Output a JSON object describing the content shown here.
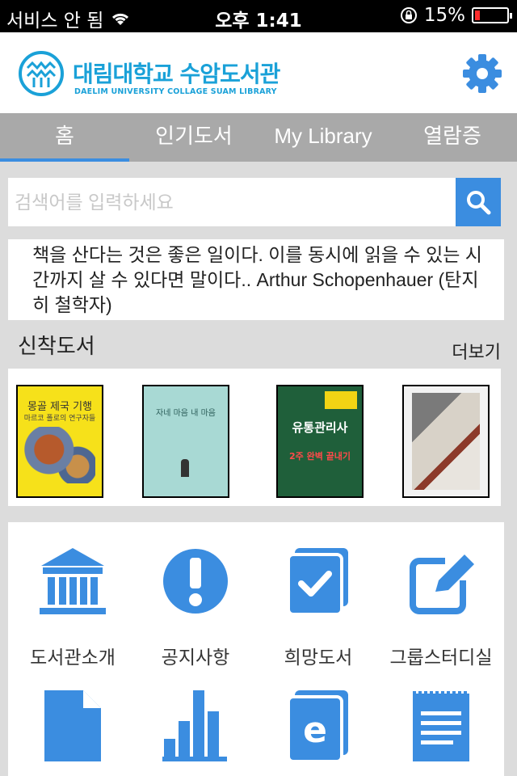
{
  "status_bar": {
    "carrier": "서비스 안 됨",
    "time": "오후 1:41",
    "battery": "15%",
    "battery_level": 0.15
  },
  "header": {
    "title": "대림대학교 수암도서관",
    "subtitle": "DAELIM UNIVERSITY COLLAGE SUAM LIBRARY"
  },
  "tabs": [
    {
      "label": "홈",
      "active": true
    },
    {
      "label": "인기도서",
      "active": false
    },
    {
      "label": "My Library",
      "active": false
    },
    {
      "label": "열람증",
      "active": false
    }
  ],
  "search": {
    "placeholder": "검색어를 입력하세요",
    "value": ""
  },
  "quote": "책을 산다는 것은 좋은 일이다. 이를 동시에 읽을 수 있는 시간까지 살 수 있다면 말이다.. Arthur Schopenhauer (탄지히 철학자)",
  "new_books": {
    "title": "신착도서",
    "more": "더보기",
    "books": [
      {
        "cover_text": "몽골 제국 기행",
        "cover_sub": "마르코 폴로의 연구자들"
      },
      {
        "cover_text": "자네 마음 내 마음",
        "cover_sub": ""
      },
      {
        "cover_text": "유통관리사",
        "cover_sub": "2주 완벽 끝내기"
      },
      {
        "cover_text": "",
        "cover_sub": ""
      }
    ]
  },
  "menu": [
    {
      "label": "도서관소개",
      "icon": "library-building-icon"
    },
    {
      "label": "공지사항",
      "icon": "exclamation-icon"
    },
    {
      "label": "희망도서",
      "icon": "checkbook-icon"
    },
    {
      "label": "그룹스터디실",
      "icon": "edit-pencil-icon"
    },
    {
      "label": "",
      "icon": "document-icon"
    },
    {
      "label": "",
      "icon": "bar-chart-icon"
    },
    {
      "label": "",
      "icon": "ebook-icon"
    },
    {
      "label": "",
      "icon": "notepad-icon"
    }
  ],
  "colors": {
    "accent": "#3b8de0",
    "brand": "#1aa1d8",
    "tab_bar": "#a9a9a9",
    "background": "#dcdcdc"
  }
}
